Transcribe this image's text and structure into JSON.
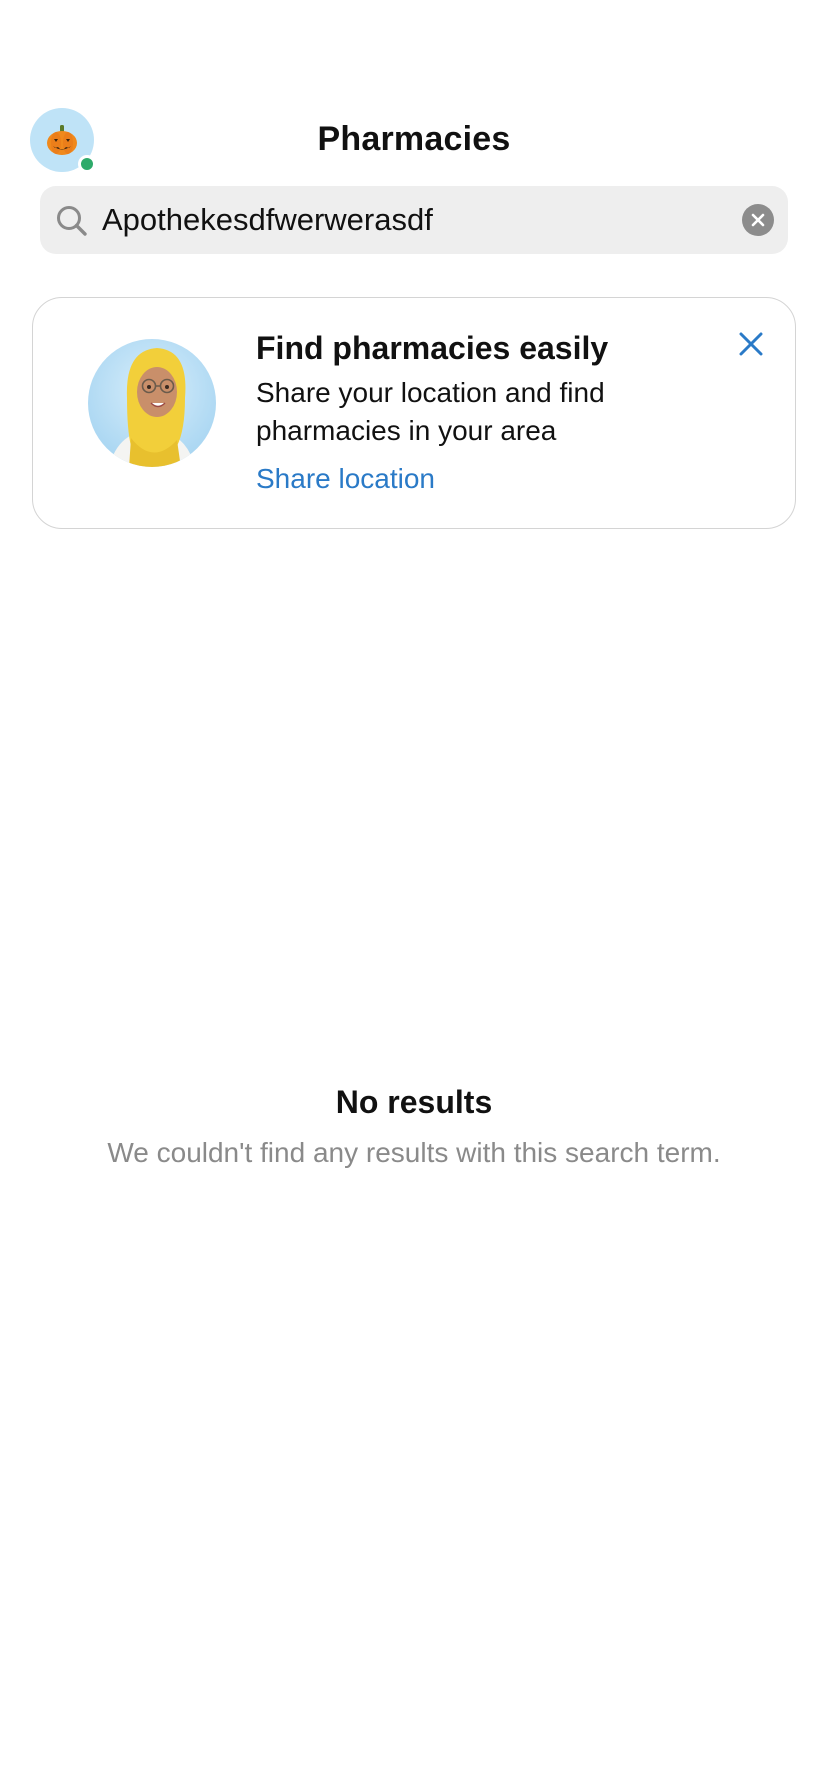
{
  "header": {
    "title": "Pharmacies",
    "avatar": {
      "icon": "pumpkin-icon",
      "status": "online",
      "status_color": "#2eaa6a",
      "background_color": "#bfe3f7"
    }
  },
  "search": {
    "value": "Apothekesdfwerwerasdf",
    "placeholder": "",
    "search_icon": "search-icon",
    "clear_icon": "clear-icon"
  },
  "promo": {
    "title": "Find pharmacies easily",
    "body": "Share your location and find pharmacies in your area",
    "link_label": "Share location",
    "link_color": "#2a7ac7",
    "illustration": "pharmacist-avatar-illustration",
    "dismiss_icon": "close-icon"
  },
  "empty_state": {
    "title": "No results",
    "message": "We couldn't find any results with this search term."
  }
}
